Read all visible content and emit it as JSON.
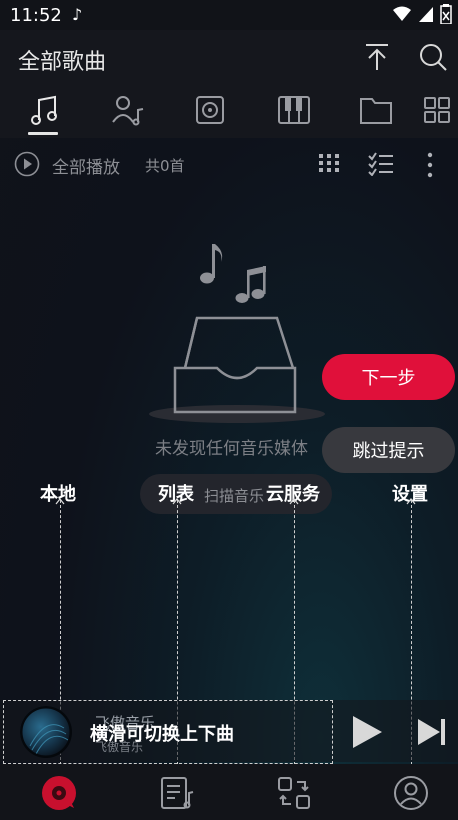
{
  "status_bar": {
    "time": "11:52",
    "notification_icon": "music-note-icon",
    "icons": [
      "wifi-icon",
      "signal-icon",
      "battery-icon"
    ]
  },
  "app_bar": {
    "title": "全部歌曲",
    "icons": [
      "upload-top-icon",
      "search-icon"
    ]
  },
  "tabs": [
    {
      "icon": "music-note-icon",
      "active": true
    },
    {
      "icon": "artist-icon",
      "active": false
    },
    {
      "icon": "album-icon",
      "active": false
    },
    {
      "icon": "piano-icon",
      "active": false
    },
    {
      "icon": "folder-icon",
      "active": false
    },
    {
      "icon": "grid-icon",
      "active": false
    }
  ],
  "play_bar": {
    "play_all_label": "全部播放",
    "count_label": "共0首",
    "icons": [
      "grid-dots-icon",
      "checklist-icon",
      "more-vertical-icon"
    ]
  },
  "empty_state": {
    "message": "未发现任何音乐媒体",
    "scan_button": "扫描音乐"
  },
  "guide_overlay": {
    "next_button": "下一步",
    "skip_button": "跳过提示",
    "labels": [
      "本地",
      "列表",
      "云服务",
      "设置"
    ],
    "mini_player_hint": "横滑可切换上下曲"
  },
  "mini_player": {
    "title": "飞傲音乐",
    "artist": "飞傲音乐"
  },
  "bottom_nav": [
    {
      "icon": "vinyl-icon",
      "active": true
    },
    {
      "icon": "playlist-icon",
      "active": false
    },
    {
      "icon": "cloud-sync-icon",
      "active": false
    },
    {
      "icon": "user-icon",
      "active": false
    }
  ],
  "colors": {
    "accent": "#e0103a",
    "background": "#10131a",
    "muted_text": "#8d8f95"
  }
}
